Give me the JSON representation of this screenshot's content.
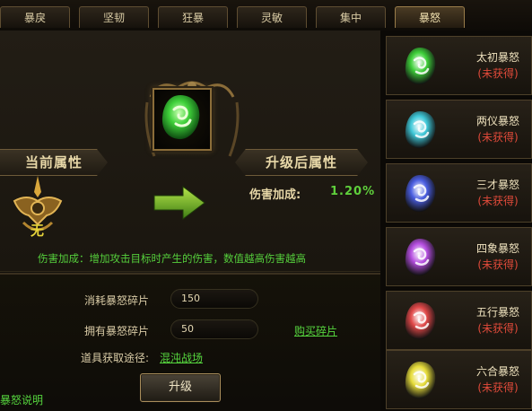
{
  "tabs": [
    {
      "label": "暴戾",
      "active": false
    },
    {
      "label": "坚韧",
      "active": false
    },
    {
      "label": "狂暴",
      "active": false
    },
    {
      "label": "灵敏",
      "active": false
    },
    {
      "label": "集中",
      "active": false
    },
    {
      "label": "暴怒",
      "active": true
    }
  ],
  "main": {
    "current_banner": "当前属性",
    "upgraded_banner": "升级后属性",
    "emblem_glyph": "无",
    "stat_label": "伤害加成:",
    "stat_value": "1.20%",
    "description": "伤害加成：增加攻击目标时产生的伤害，数值越高伤害越高",
    "consume_label": "消耗暴怒碎片",
    "consume_value": "150",
    "own_label": "拥有暴怒碎片",
    "own_value": "50",
    "buy_link": "购买碎片",
    "source_label": "道具获取途径:",
    "source_link": "混沌战场",
    "upgrade_button": "升级",
    "help_link": "暴怒说明"
  },
  "list": [
    {
      "name": "太初暴怒",
      "status": "(未获得)",
      "gem_color": "#3fd03a",
      "gem_icon": "rage-gem-icon"
    },
    {
      "name": "两仪暴怒",
      "status": "(未获得)",
      "gem_color": "#3fc8d8",
      "gem_icon": "rage-gem-icon"
    },
    {
      "name": "三才暴怒",
      "status": "(未获得)",
      "gem_color": "#4a5de0",
      "gem_icon": "rage-gem-icon"
    },
    {
      "name": "四象暴怒",
      "status": "(未获得)",
      "gem_color": "#b54ee0",
      "gem_icon": "rage-gem-icon"
    },
    {
      "name": "五行暴怒",
      "status": "(未获得)",
      "gem_color": "#e04848",
      "gem_icon": "rage-gem-icon"
    },
    {
      "name": "六合暴怒",
      "status": "(未获得)",
      "gem_color": "#e6dc3a",
      "gem_icon": "rage-gem-icon"
    }
  ],
  "colors": {
    "accent_green": "#56d63e",
    "not_obtained_red": "#e04a3a",
    "frame_gold": "#8b6d39"
  }
}
